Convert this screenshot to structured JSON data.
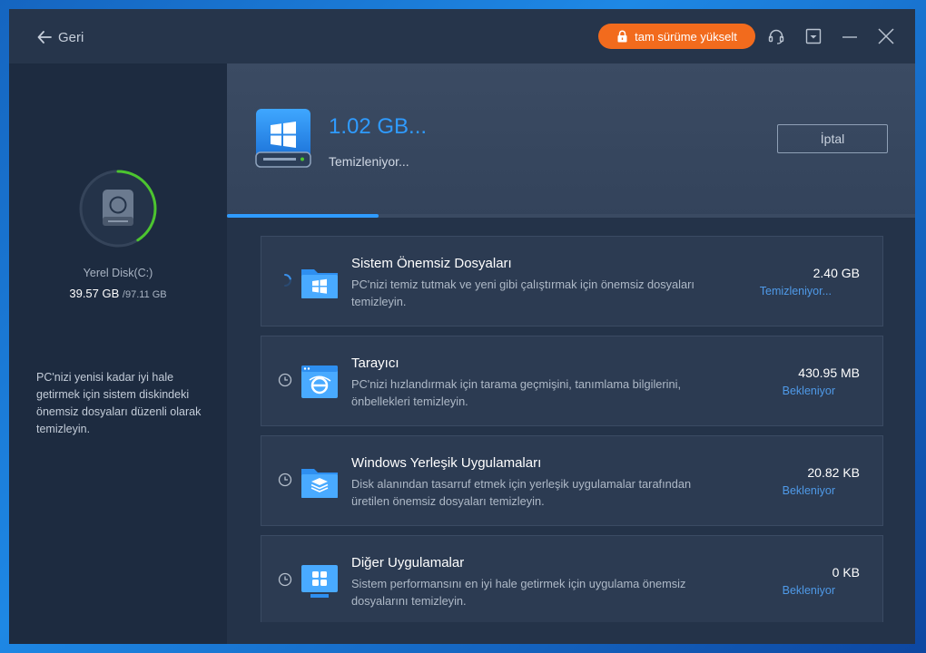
{
  "header": {
    "back_label": "Geri",
    "upgrade_label": "tam sürüme yükselt"
  },
  "sidebar": {
    "disk_label": "Yerel Disk(C:)",
    "used": "39.57 GB",
    "total": "/97.11 GB",
    "used_fraction": 0.41,
    "description": "PC'nizi yenisi kadar iyi hale getirmek için sistem diskindeki önemsiz dosyaları düzenli olarak temizleyin."
  },
  "main": {
    "cleaned_size": "1.02 GB...",
    "status": "Temizleniyor...",
    "cancel_label": "İptal",
    "progress": 0.22
  },
  "items": [
    {
      "title": "Sistem Önemsiz Dosyaları",
      "description": "PC'nizi temiz tutmak ve yeni gibi çalıştırmak için önemsiz dosyaları temizleyin.",
      "size": "2.40 GB",
      "status": "Temizleniyor...",
      "icon": "windows-folder-icon",
      "state": "spinner-icon"
    },
    {
      "title": "Tarayıcı",
      "description": "PC'nizi hızlandırmak için tarama geçmişini, tanımlama bilgilerini, önbellekleri temizleyin.",
      "size": "430.95 MB",
      "status": "Bekleniyor",
      "icon": "browser-icon",
      "state": "clock-icon"
    },
    {
      "title": "Windows Yerleşik Uygulamaları",
      "description": "Disk alanından tasarruf etmek için yerleşik uygulamalar tarafından üretilen önemsiz dosyaları temizleyin.",
      "size": "20.82 KB",
      "status": "Bekleniyor",
      "icon": "apps-folder-icon",
      "state": "clock-icon"
    },
    {
      "title": "Diğer Uygulamalar",
      "description": "Sistem performansını en iyi hale getirmek için uygulama önemsiz dosyalarını temizleyin.",
      "size": "0 KB",
      "status": "Bekleniyor",
      "icon": "monitor-apps-icon",
      "state": "clock-icon"
    }
  ],
  "colors": {
    "accent": "#2f9bff",
    "upgrade": "#f26b1d",
    "ring": "#4cc52f"
  }
}
